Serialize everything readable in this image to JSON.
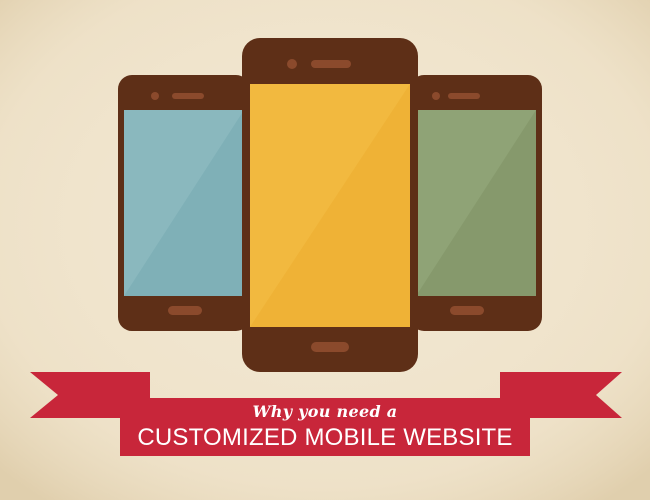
{
  "banner": {
    "tagline": "Why you need a",
    "headline": "CUSTOMIZED MOBILE WEBSITE"
  },
  "colors": {
    "background": "#f1e6d0",
    "phone_body": "#5e2f17",
    "phone_detail": "#8b4a2c",
    "screen_left": "#8ab8be",
    "screen_center": "#f2b93f",
    "screen_right": "#8fa376",
    "ribbon": "#c8263a",
    "ribbon_fold": "#8e1525"
  },
  "phones": [
    {
      "name": "left-phone",
      "screen_color": "#8ab8be"
    },
    {
      "name": "center-phone",
      "screen_color": "#f2b93f"
    },
    {
      "name": "right-phone",
      "screen_color": "#8fa376"
    }
  ]
}
